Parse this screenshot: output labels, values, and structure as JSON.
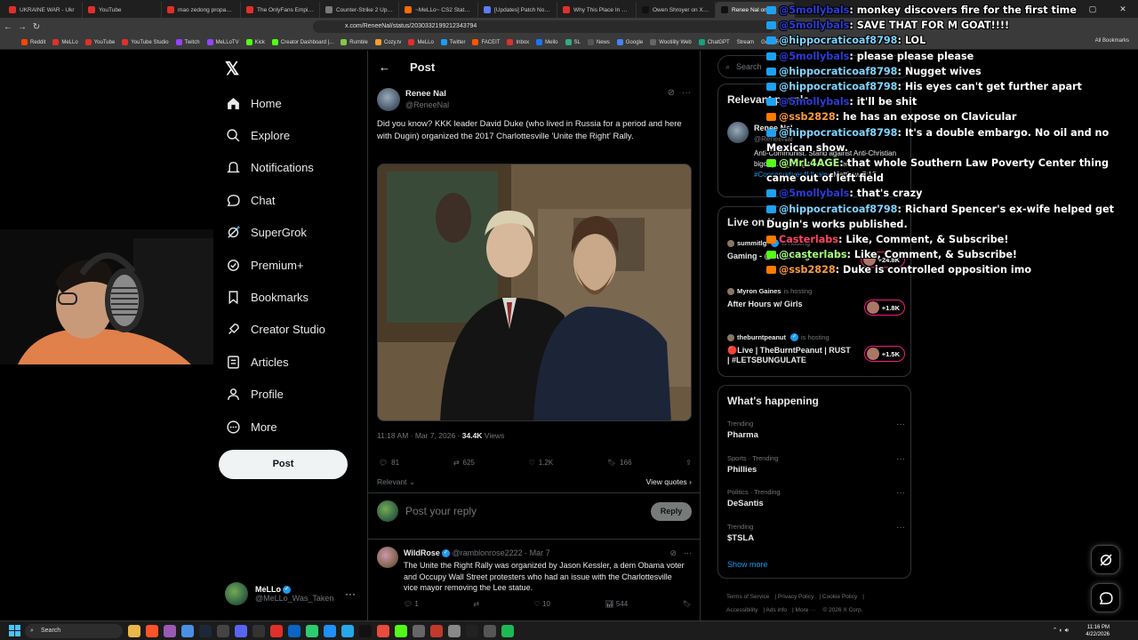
{
  "browser": {
    "tabs": [
      {
        "title": "UKRAINE WAR - Ukr",
        "color": "#e0302a"
      },
      {
        "title": "YouTube",
        "color": "#e0302a"
      },
      {
        "title": "mao zedong propagan",
        "color": "#e0302a"
      },
      {
        "title": "The OnlyFans Empire is",
        "color": "#e0302a"
      },
      {
        "title": "Counter-Strike 2 Update",
        "color": "#7a7a7a"
      },
      {
        "title": "~MeLLo~ CS2 Stats - FR",
        "color": "#ff6a00"
      },
      {
        "title": "[Updates] Patch Notes V",
        "color": "#5c7cfa"
      },
      {
        "title": "Why This Place In Red D",
        "color": "#e0302a"
      },
      {
        "title": "Owen Shroyer on X: \"All",
        "color": "#111111"
      },
      {
        "title": "Renee Nal on X",
        "color": "#111111",
        "active": true
      }
    ],
    "url": "x.com/ReneeNal/status/2030332199212343794",
    "bookmarks": [
      {
        "label": "Reddit",
        "color": "#ff4500"
      },
      {
        "label": "MeLLo",
        "color": "#e0302a"
      },
      {
        "label": "YouTube",
        "color": "#e0302a"
      },
      {
        "label": "YouTube Studio",
        "color": "#e0302a"
      },
      {
        "label": "Twitch",
        "color": "#9146ff"
      },
      {
        "label": "MeLLoTV",
        "color": "#9146ff"
      },
      {
        "label": "Kick",
        "color": "#53fc18"
      },
      {
        "label": "Creator Dashboard |...",
        "color": "#53fc18"
      },
      {
        "label": "Rumble",
        "color": "#85c742"
      },
      {
        "label": "Cozy.tv",
        "color": "#f0a030"
      },
      {
        "label": "MeLLo",
        "color": "#e0302a"
      },
      {
        "label": "Twitter",
        "color": "#1d9bf0"
      },
      {
        "label": "FACEIT",
        "color": "#ff5500"
      },
      {
        "label": "Inbox",
        "color": "#e0302a"
      },
      {
        "label": "Mello",
        "color": "#1877f2"
      },
      {
        "label": "SL",
        "color": "#3a8"
      },
      {
        "label": "News",
        "color": "#555"
      },
      {
        "label": "Google",
        "color": "#4285f4"
      },
      {
        "label": "Wootility Web",
        "color": "#666"
      },
      {
        "label": "ChatGPT",
        "color": "#10a37f"
      }
    ],
    "bookmarks_tail": [
      "Stream",
      "Good Reads",
      "More"
    ],
    "all_bookmarks": "All Bookmarks",
    "window_controls": [
      "—",
      "▢",
      "✕"
    ]
  },
  "sidebar": {
    "logo": "𝕏",
    "items": [
      {
        "label": "Home",
        "icon": "home-icon"
      },
      {
        "label": "Explore",
        "icon": "search-icon"
      },
      {
        "label": "Notifications",
        "icon": "bell-icon"
      },
      {
        "label": "Chat",
        "icon": "chat-icon"
      },
      {
        "label": "SuperGrok",
        "icon": "grok-icon"
      },
      {
        "label": "Premium+",
        "icon": "premium-icon"
      },
      {
        "label": "Bookmarks",
        "icon": "bookmark-icon"
      },
      {
        "label": "Creator Studio",
        "icon": "rocket-icon"
      },
      {
        "label": "Articles",
        "icon": "article-icon"
      },
      {
        "label": "Profile",
        "icon": "profile-icon"
      },
      {
        "label": "More",
        "icon": "more-icon"
      }
    ],
    "post_button": "Post",
    "account": {
      "name": "MeLLo",
      "handle": "@MeLLo_Was_Taken",
      "more": "···"
    }
  },
  "main": {
    "header_title": "Post",
    "post": {
      "author_name": "Renee Nal",
      "author_handle": "@ReneeNal",
      "text": "Did you know? KKK leader David Duke (who lived in Russia for a period and here with Dugin) organized the 2017 Charlottesville 'Unite the Right' Rally.",
      "time": "11:18 AM · Mar 7, 2026 · ",
      "views_count": "34.4K",
      "views_label": " Views",
      "replies": "81",
      "reposts": "625",
      "likes": "1.2K",
      "bookmarks": "166",
      "sort_label": "Relevant",
      "view_quotes": "View quotes"
    },
    "reply_box": {
      "placeholder": "Post your reply",
      "button": "Reply"
    },
    "reply": {
      "name": "WildRose",
      "handle": "@ramblonrose2222 · Mar 7",
      "text": "The Unite the Right Rally was organized by Jason Kessler, a dem Obama voter and Occupy Wall Street protesters who had an issue with the Charlottesville vice mayor removing the Lee statue.",
      "replies": "1",
      "reposts": "",
      "likes": "10",
      "views": "544"
    }
  },
  "right": {
    "search_placeholder": "Search",
    "relevant": {
      "title": "Relevant people",
      "name": "Renee Nal",
      "handle": "@ReneeNal",
      "bio_text": "Anti-Communist. Stand against Anti-Christian bigotry... fighting the SAME enemy. ",
      "bio_tag": "#Conservatives4Ukraine",
      "bio_tail": " Matthew 7:12"
    },
    "live": {
      "title": "Live on X",
      "items": [
        {
          "host": "summitlg",
          "hosting": "is hosting",
          "title": "Gaming - @summit1g",
          "count": "+24.8K"
        },
        {
          "host": "Myron Gaines",
          "hosting": "is hosting",
          "title": "After Hours w/ Girls",
          "count": "+1.8K"
        },
        {
          "host": "theburntpeanut",
          "hosting": "is hosting",
          "title": "🔴Live | TheBurntPeanut | RUST | #LETSBUNGULATE",
          "count": "+1.5K"
        }
      ]
    },
    "happening": {
      "title": "What's happening",
      "trends": [
        {
          "category": "Trending",
          "name": "Pharma"
        },
        {
          "category": "Sports · Trending",
          "name": "Phillies"
        },
        {
          "category": "Politics · Trending",
          "name": "DeSantis"
        },
        {
          "category": "Trending",
          "name": "$TSLA"
        }
      ],
      "show_more": "Show more"
    },
    "footer": [
      "Terms of Service",
      "Privacy Policy",
      "Cookie Policy",
      "Accessibility",
      "Ads info",
      "More ···",
      "© 2026 X Corp."
    ]
  },
  "chat": [
    {
      "user": "@5mollybals",
      "text": "monkey discovers fire for the first time",
      "ucolor": "#2b3bd8",
      "platform": "#1da1f2"
    },
    {
      "user": "@5mollybals",
      "text": "SAVE THAT FOR M GOAT!!!!",
      "ucolor": "#2b3bd8",
      "platform": "#1da1f2"
    },
    {
      "user": "@hippocraticoaf8798",
      "text": "LOL",
      "ucolor": "#7fd4ff",
      "platform": "#1da1f2"
    },
    {
      "user": "@5mollybals",
      "text": "please please please",
      "ucolor": "#2b3bd8",
      "platform": "#1da1f2"
    },
    {
      "user": "@hippocraticoaf8798",
      "text": "Nugget wives",
      "ucolor": "#7fd4ff",
      "platform": "#1da1f2"
    },
    {
      "user": "@hippocraticoaf8798",
      "text": "His eyes can't get further apart",
      "ucolor": "#7fd4ff",
      "platform": "#1da1f2"
    },
    {
      "user": "@5mollybals",
      "text": "it'll be shit",
      "ucolor": "#2b3bd8",
      "platform": "#1da1f2"
    },
    {
      "user": "@ssb2828",
      "text": "he has an expose on Clavicular",
      "ucolor": "#ff9a40",
      "platform": "#ff7a00"
    },
    {
      "user": "@hippocraticoaf8798",
      "text": "It's a double embargo. No oil and no Mexican show.",
      "ucolor": "#7fd4ff",
      "platform": "#1da1f2"
    },
    {
      "user": "@MrL4AGE",
      "text": "that whole Southern Law Poverty Center thing came out of left field",
      "ucolor": "#a8ff7a",
      "platform": "#53fc18"
    },
    {
      "user": "@5mollybals",
      "text": "that's crazy",
      "ucolor": "#2b3bd8",
      "platform": "#1da1f2"
    },
    {
      "user": "@hippocraticoaf8798",
      "text": "Richard Spencer's ex-wife helped get Dugin's works published.",
      "ucolor": "#7fd4ff",
      "platform": "#1da1f2"
    },
    {
      "user": "Casterlabs",
      "text": "Like, Comment, & Subscribe!",
      "ucolor": "#ff4466",
      "platform": "#ff7a00"
    },
    {
      "user": "@casterlabs",
      "text": "Like, Comment, & Subscribe!",
      "ucolor": "#a8ff7a",
      "platform": "#53fc18"
    },
    {
      "user": "@ssb2828",
      "text": "Duke is controlled opposition imo",
      "ucolor": "#ff9a40",
      "platform": "#ff7a00"
    }
  ],
  "taskbar": {
    "search": "Search",
    "time": "11:16 PM",
    "date": "4/22/2026"
  }
}
